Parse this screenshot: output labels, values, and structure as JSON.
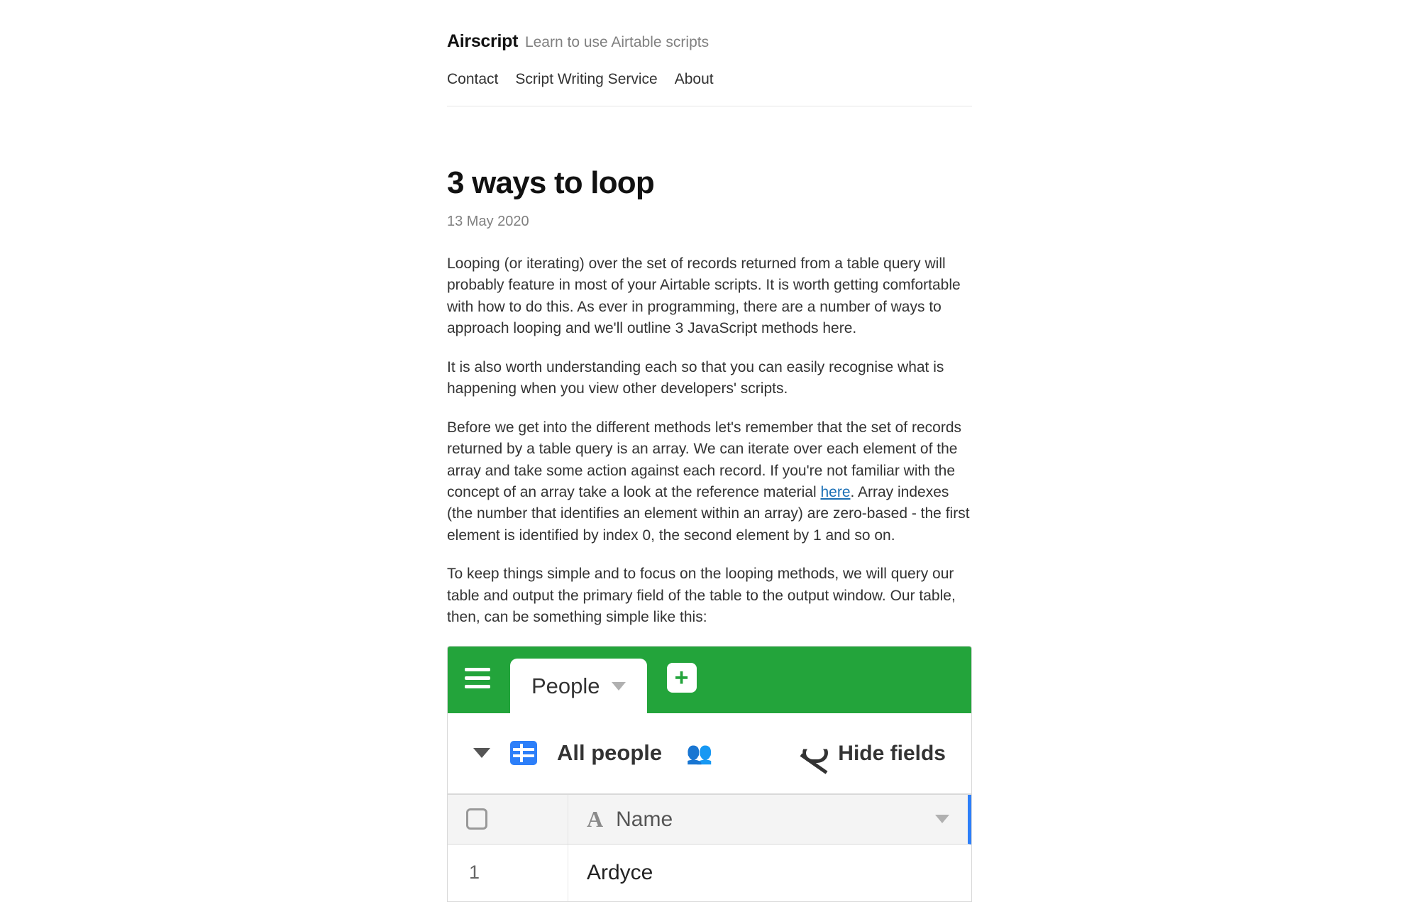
{
  "header": {
    "brand": "Airscript",
    "tagline": "Learn to use Airtable scripts",
    "nav": {
      "contact": "Contact",
      "sws": "Script Writing Service",
      "about": "About"
    }
  },
  "post": {
    "title": "3 ways to loop",
    "date": "13 May 2020",
    "para1": "Looping (or iterating) over the set of records returned from a table query will probably feature in most of your Airtable scripts. It is worth getting comfortable with how to do this. As ever in programming, there are a number of ways to approach looping and we'll outline 3 JavaScript methods here.",
    "para2": "It is also worth understanding each so that you can easily recognise what is happening when you view other developers' scripts.",
    "para3_pre": "Before we get into the different methods let's remember that the set of records returned by a table query is an array. We can iterate over each element of the array and take some action against each record. If you're not familiar with the concept of an array take a look at the reference material ",
    "para3_link": "here",
    "para3_post": ". Array indexes (the number that identifies an element within an array) are zero-based - the first element is identified by index 0, the second element by 1 and so on.",
    "para4": "To keep things simple and to focus on the looping methods, we will query our table and output the primary field of the table to the output window. Our table, then, can be something simple like this:"
  },
  "airtable": {
    "tab_name": "People",
    "view_name": "All people",
    "hide_fields": "Hide fields",
    "column_name": "Name",
    "row1_num": "1",
    "row1_val": "Ardyce"
  }
}
